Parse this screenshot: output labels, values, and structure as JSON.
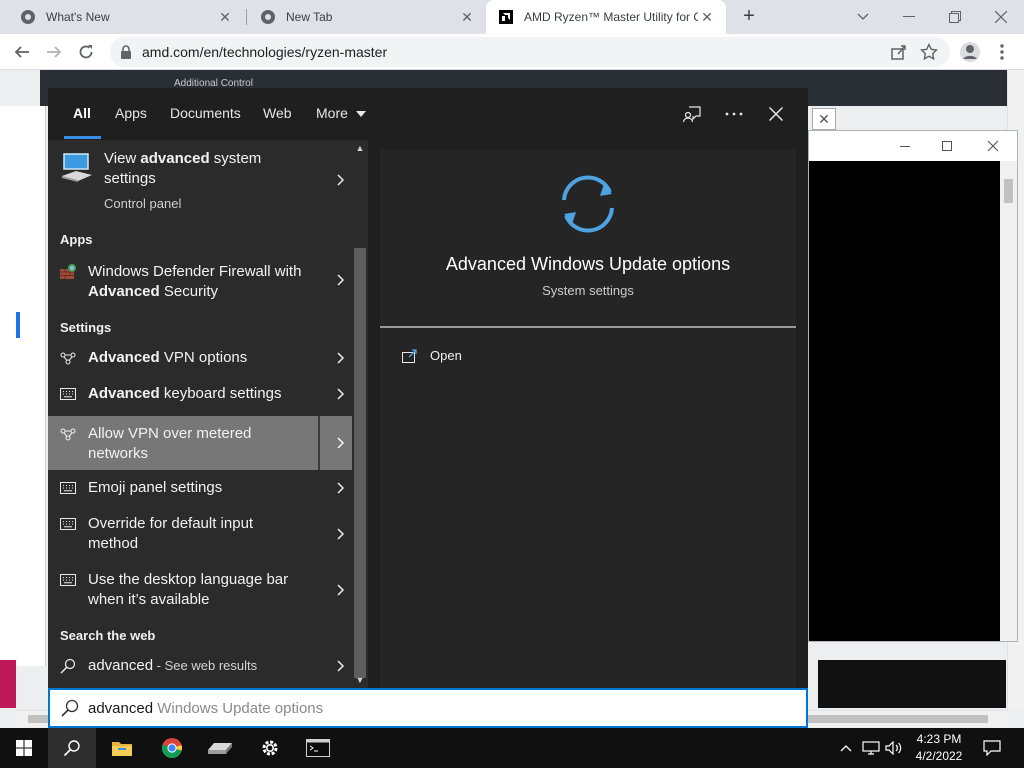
{
  "browser": {
    "tabs": [
      {
        "title": "What's New",
        "icon": "chrome-icon",
        "active": false
      },
      {
        "title": "New Tab",
        "icon": "chrome-icon",
        "active": false
      },
      {
        "title": "AMD Ryzen™ Master Utility for C",
        "icon": "amd-icon",
        "active": true
      }
    ],
    "tab_close_glyph": "✕",
    "new_tab_glyph": "+",
    "url": "amd.com/en/technologies/ryzen-master"
  },
  "website": {
    "header_small_text": "Additional Control"
  },
  "search": {
    "tabs": [
      {
        "label": "All",
        "active": true
      },
      {
        "label": "Apps"
      },
      {
        "label": "Documents"
      },
      {
        "label": "Web"
      },
      {
        "label": "More"
      }
    ],
    "best_match": {
      "title_pre": "View ",
      "title_bold": "advanced",
      "title_post": " system",
      "title_line2": "settings",
      "subtitle": "Control panel",
      "icon": "system-settings-icon"
    },
    "sections": {
      "apps": "Apps",
      "settings": "Settings",
      "web": "Search the web"
    },
    "apps_items": [
      {
        "pre": "Windows Defender Firewall with",
        "bold": "Advanced",
        "post": " Security",
        "icon": "firewall-icon"
      }
    ],
    "settings_items": [
      {
        "bold": "Advanced",
        "post": " VPN options",
        "icon": "vpn-icon"
      },
      {
        "bold": "Advanced",
        "post": " keyboard settings",
        "icon": "keyboard-icon"
      },
      {
        "line1": "Allow VPN over metered",
        "line2": "networks",
        "icon": "vpn-icon",
        "selected": true
      },
      {
        "line1": "Emoji panel settings",
        "icon": "keyboard-icon"
      },
      {
        "line1": "Override for default input",
        "line2": "method",
        "icon": "keyboard-icon"
      },
      {
        "line1": "Use the desktop language bar",
        "line2": "when it’s available",
        "icon": "keyboard-icon"
      }
    ],
    "web_item": {
      "query": "advanced",
      "suffix": " - See web results",
      "icon": "search-icon"
    },
    "detail": {
      "title": "Advanced Windows Update options",
      "subtitle": "System settings",
      "action": "Open",
      "icon": "windows-update-icon"
    },
    "query_typed": "advanced",
    "query_completion": " Windows Update options"
  },
  "taskbar": {
    "apps": [
      "start-icon",
      "search-icon",
      "file-explorer-icon",
      "chrome-icon",
      "drive-icon",
      "settings-icon",
      "terminal-icon"
    ],
    "time": "4:23 PM",
    "date": "4/2/2022"
  },
  "colors": {
    "accent": "#0078d7",
    "underline": "#3a8ee6",
    "update_icon": "#4fa3e0"
  }
}
